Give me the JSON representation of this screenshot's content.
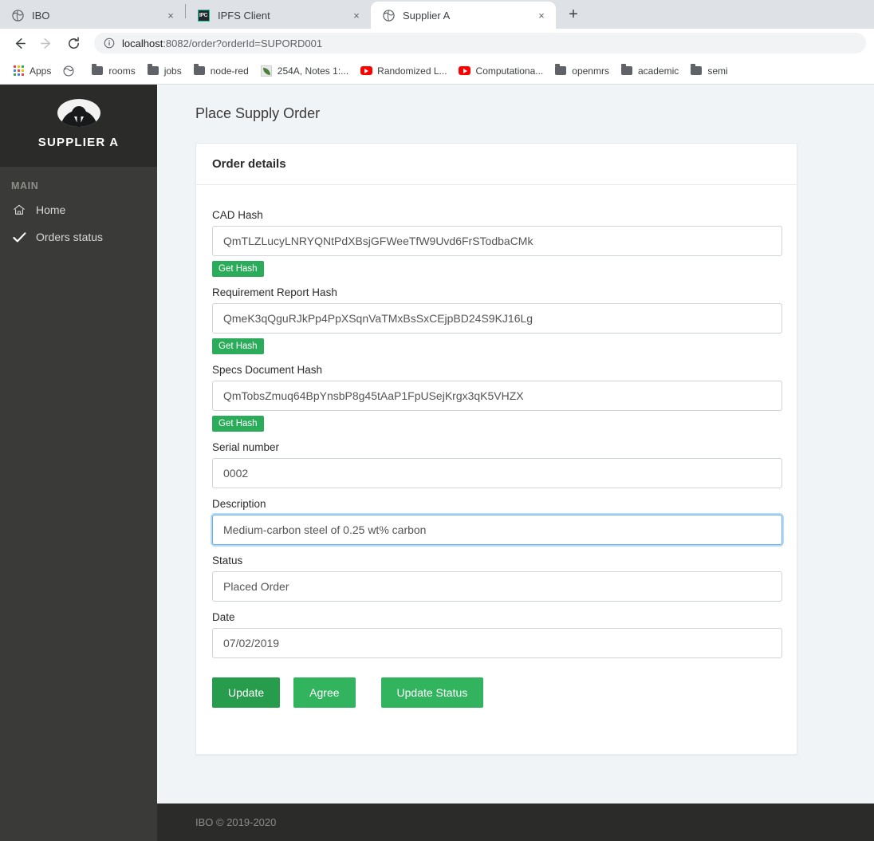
{
  "browser": {
    "tabs": [
      {
        "title": "IBO",
        "favicon": "globe-icon",
        "active": false,
        "close_label": "×"
      },
      {
        "title": "IPFS Client",
        "favicon": "ipfs-icon",
        "active": false,
        "close_label": "×"
      },
      {
        "title": "Supplier A",
        "favicon": "globe-icon",
        "active": true,
        "close_label": "×"
      }
    ],
    "new_tab_label": "+",
    "nav": {
      "back": "←",
      "forward": "→",
      "reload": "⟳"
    },
    "omnibox": {
      "info_icon": "info-circle-icon",
      "url_host": "localhost",
      "url_rest": ":8082/order?orderId=SUPORD001"
    },
    "bookmarks": [
      {
        "label": "Apps",
        "icon": "apps-grid-icon"
      },
      {
        "label": "",
        "icon": "globe-icon"
      },
      {
        "label": "rooms",
        "icon": "folder-icon"
      },
      {
        "label": "jobs",
        "icon": "folder-icon"
      },
      {
        "label": "node-red",
        "icon": "folder-icon"
      },
      {
        "label": "254A, Notes 1:...",
        "icon": "leaf-icon"
      },
      {
        "label": "Randomized L...",
        "icon": "youtube-icon"
      },
      {
        "label": "Computationa...",
        "icon": "youtube-icon"
      },
      {
        "label": "openmrs",
        "icon": "folder-icon"
      },
      {
        "label": "academic",
        "icon": "folder-icon"
      },
      {
        "label": "semi",
        "icon": "folder-icon"
      }
    ]
  },
  "sidebar": {
    "brand": "SUPPLIER A",
    "avatar_icon": "user-avatar-icon",
    "section_label": "MAIN",
    "items": [
      {
        "label": "Home",
        "icon": "home-icon"
      },
      {
        "label": "Orders status",
        "icon": "check-icon"
      }
    ]
  },
  "page": {
    "title": "Place Supply Order",
    "card_title": "Order details",
    "fields": [
      {
        "label": "CAD Hash",
        "value": "QmTLZLucyLNRYQNtPdXBsjGFWeeTfW9Uvd6FrSTodbaCMk",
        "button": "Get Hash"
      },
      {
        "label": "Requirement Report Hash",
        "value": "QmeK3qQguRJkPp4PpXSqnVaTMxBsSxCEjpBD24S9KJ16Lg",
        "button": "Get Hash"
      },
      {
        "label": "Specs Document Hash",
        "value": "QmTobsZmuq64BpYnsbP8g45tAaP1FpUSejKrgx3qK5VHZX",
        "button": "Get Hash"
      },
      {
        "label": "Serial number",
        "value": "0002",
        "button": null
      },
      {
        "label": "Description",
        "value": "Medium-carbon steel of 0.25 wt% carbon",
        "button": null,
        "focused": true
      },
      {
        "label": "Status",
        "value": "Placed Order",
        "button": null
      },
      {
        "label": "Date",
        "value": "07/02/2019",
        "button": null
      }
    ],
    "actions": [
      {
        "label": "Update",
        "state": "hover"
      },
      {
        "label": "Agree",
        "state": "normal"
      },
      {
        "label": "Update Status",
        "state": "normal"
      }
    ],
    "footer": "IBO © 2019-2020"
  },
  "colors": {
    "accent_green": "#32b35e",
    "accent_green_hover": "#269c4c",
    "sidebar_bg": "#3a3a38",
    "sidebar_brand_bg": "#2b2b29",
    "page_bg": "#f1f4f7",
    "focus_blue": "#66afe9"
  }
}
